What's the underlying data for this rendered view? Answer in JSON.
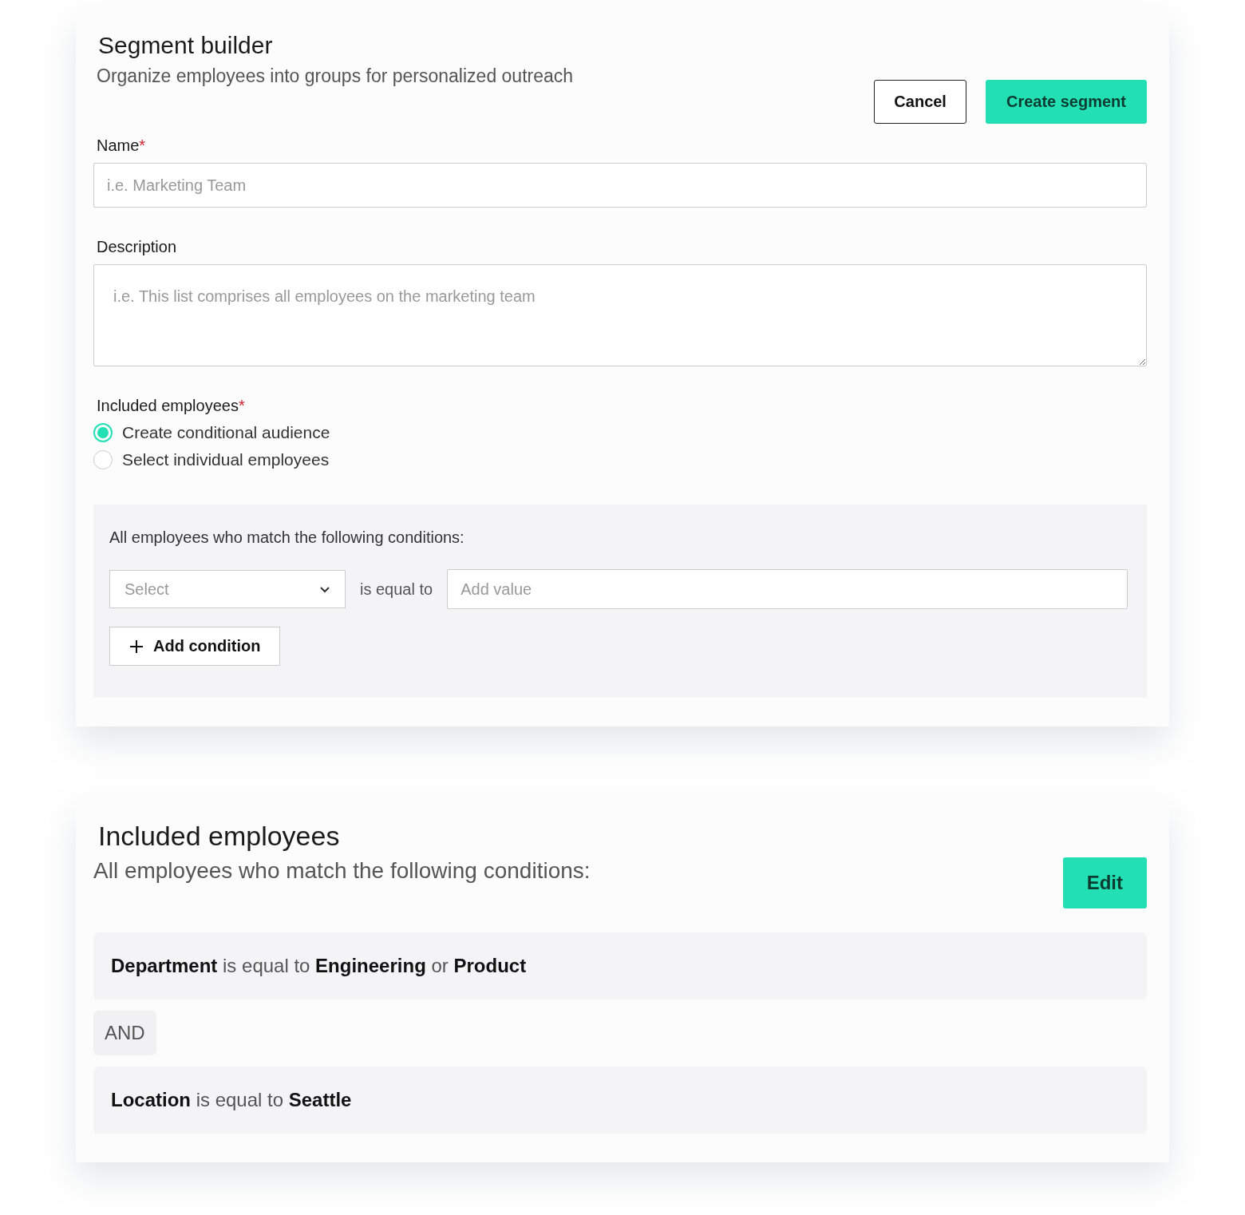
{
  "builder": {
    "title": "Segment builder",
    "subtitle": "Organize employees into groups for personalized outreach",
    "buttons": [
      {
        "kind": "secondary",
        "label": "Cancel"
      },
      {
        "kind": "primary",
        "label": "Create segment"
      }
    ],
    "name_field": {
      "label": "Name",
      "required_mark": "*",
      "placeholder": "i.e. Marketing Team"
    },
    "description_field": {
      "label": "Description",
      "placeholder": "i.e. This list comprises all employees on the marketing team"
    },
    "included": {
      "label": "Included employees",
      "required_mark": "*",
      "options": [
        {
          "label": "Create conditional audience",
          "selected": true
        },
        {
          "label": "Select individual employees",
          "selected": false
        }
      ]
    },
    "conditions_panel": {
      "heading": "All employees who match the following conditions:",
      "select_placeholder": "Select",
      "operator": "is equal to",
      "value_placeholder": "Add value",
      "add_button": "Add condition"
    }
  },
  "summary": {
    "title": "Included employees",
    "subtitle": "All employees who match the following conditions:",
    "edit_button": "Edit",
    "rows": [
      {
        "kind": "condition",
        "text": "**Department** is equal to **Engineering** or **Product**"
      },
      {
        "kind": "joiner",
        "text": "AND"
      },
      {
        "kind": "condition",
        "text": "**Location** is equal to **Seattle**"
      }
    ]
  }
}
